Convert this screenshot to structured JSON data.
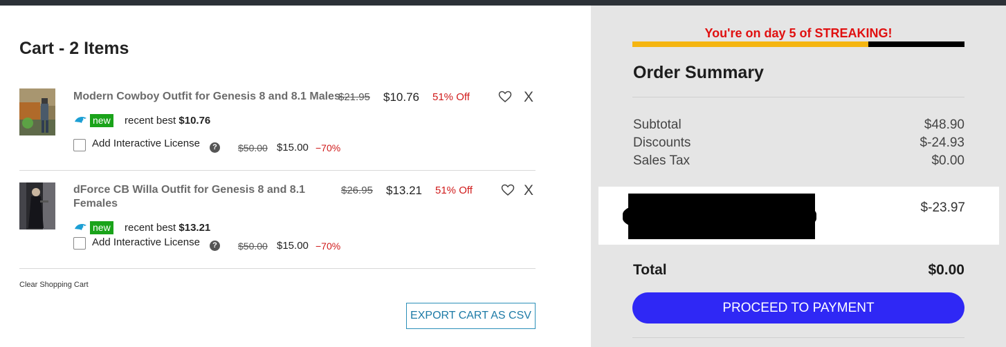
{
  "cart": {
    "title": "Cart - 2 Items",
    "items": [
      {
        "name": "Modern Cowboy Outfit for Genesis 8 and 8.1 Males",
        "original_price": "$21.95",
        "price": "$10.76",
        "discount": "51% Off",
        "badge": "new",
        "recent_label": "recent best",
        "recent_price": "$10.76",
        "license_label": "Add Interactive License",
        "license_help": "?",
        "license_original": "$50.00",
        "license_price": "$15.00",
        "license_discount": "−70%",
        "remove_label": "X"
      },
      {
        "name_line1": "dForce CB Willa Outfit for Genesis 8 and 8.1",
        "name_line2": "Females",
        "original_price": "$26.95",
        "price": "$13.21",
        "discount": "51% Off",
        "badge": "new",
        "recent_label": "recent best",
        "recent_price": "$13.21",
        "license_label": "Add Interactive License",
        "license_help": "?",
        "license_original": "$50.00",
        "license_price": "$15.00",
        "license_discount": "−70%",
        "remove_label": "X"
      }
    ],
    "clear_label": "Clear Shopping Cart",
    "export_label": "EXPORT CART AS CSV"
  },
  "summary": {
    "streak_text": "You're on day 5 of STREAKING!",
    "streak_progress": 0.71,
    "title": "Order Summary",
    "rows": [
      {
        "label": "Subtotal",
        "value": "$48.90"
      },
      {
        "label": "Discounts",
        "value": "$-24.93"
      },
      {
        "label": "Sales Tax",
        "value": "$0.00"
      }
    ],
    "redacted_value": "$-23.97",
    "total_label": "Total",
    "total_value": "$0.00",
    "pay_label": "PROCEED TO PAYMENT"
  },
  "colors": {
    "accent": "#2f28f5",
    "streak_red": "#e01010",
    "streak_gold": "#f5b511",
    "discount_red": "#d01a1a",
    "badge_green": "#1aa31a"
  }
}
